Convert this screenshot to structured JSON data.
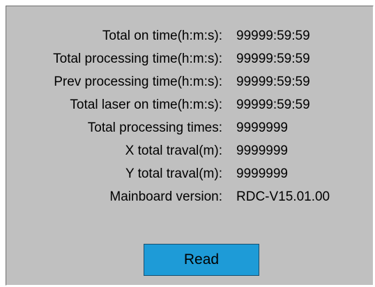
{
  "stats": {
    "rows": [
      {
        "label": "Total on time(h:m:s):",
        "value": "99999:59:59"
      },
      {
        "label": "Total processing time(h:m:s):",
        "value": "99999:59:59"
      },
      {
        "label": "Prev processing time(h:m:s):",
        "value": "99999:59:59"
      },
      {
        "label": "Total laser on time(h:m:s):",
        "value": "99999:59:59"
      },
      {
        "label": "Total processing times:",
        "value": "9999999"
      },
      {
        "label": "X total traval(m):",
        "value": "9999999"
      },
      {
        "label": "Y total traval(m):",
        "value": "9999999"
      },
      {
        "label": "Mainboard version:",
        "value": "RDC-V15.01.00"
      }
    ]
  },
  "actions": {
    "read_label": "Read"
  },
  "colors": {
    "panel_background": "#c0c0c0",
    "button_background": "#1e9bd7"
  }
}
